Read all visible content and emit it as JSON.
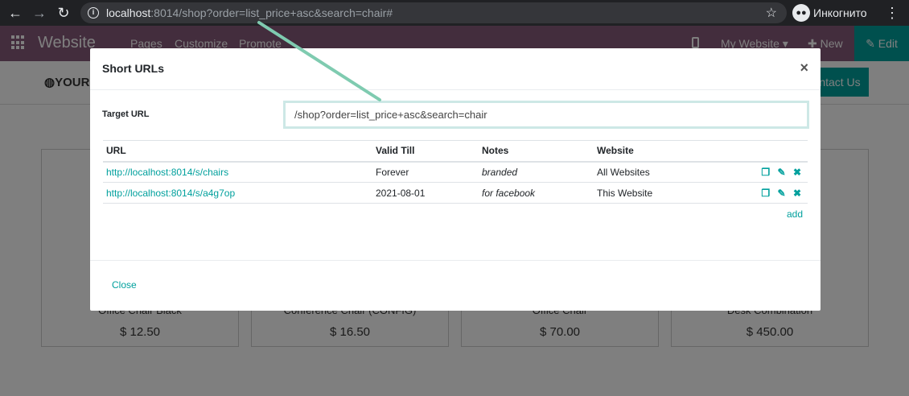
{
  "browser": {
    "url_host": "localhost",
    "url_rest": ":8014/shop?order=list_price+asc&search=chair#",
    "profile": "Инкогнито"
  },
  "app": {
    "brand": "Website",
    "menu": [
      "Pages",
      "Customize",
      "Promote"
    ],
    "my_website": "My Website",
    "new_label": "New",
    "edit_label": "Edit",
    "logo": "YOUR",
    "contact": "ntact Us"
  },
  "products": [
    {
      "name": "Office Chair Black",
      "price": "$ 12.50"
    },
    {
      "name": "Conference Chair (CONFIG)",
      "price": "$ 16.50"
    },
    {
      "name": "Office Chair",
      "price": "$ 70.00"
    },
    {
      "name": "Desk Combination",
      "price": "$ 450.00"
    }
  ],
  "modal": {
    "title": "Short URLs",
    "close_x": "×",
    "target_label": "Target URL",
    "target_value": "/shop?order=list_price+asc&search=chair",
    "columns": [
      "URL",
      "Valid Till",
      "Notes",
      "Website"
    ],
    "rows": [
      {
        "url": "http://localhost:8014/s/chairs",
        "valid": "Forever",
        "notes": "branded",
        "website": "All Websites"
      },
      {
        "url": "http://localhost:8014/s/a4g7op",
        "valid": "2021-08-01",
        "notes": "for facebook",
        "website": "This Website"
      }
    ],
    "add_label": "add",
    "close_label": "Close"
  },
  "icons": {
    "copy": "copy-icon",
    "edit": "edit-icon",
    "delete": "delete-icon"
  },
  "colors": {
    "accent": "#00a09d",
    "odoo_nav": "#875a7b",
    "arrow": "#7fcbb0"
  }
}
